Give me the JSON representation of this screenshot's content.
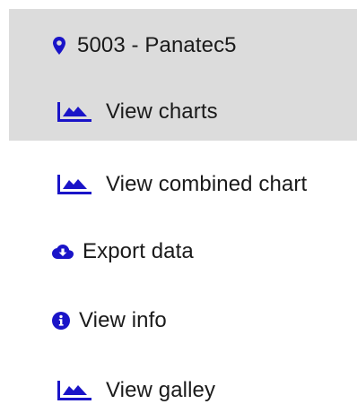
{
  "menu": {
    "items": [
      {
        "label": "5003 - Panatec5",
        "icon": "map-marker-icon"
      },
      {
        "label": "View charts",
        "icon": "area-chart-icon"
      },
      {
        "label": "View combined chart",
        "icon": "area-chart-icon"
      },
      {
        "label": "Export data",
        "icon": "cloud-download-icon"
      },
      {
        "label": "View info",
        "icon": "info-circle-icon"
      },
      {
        "label": "View galley",
        "icon": "area-chart-icon"
      }
    ]
  },
  "colors": {
    "icon": "#1a14c8",
    "text": "#1a1a1a",
    "highlight": "#dcdcdc",
    "background": "#ffffff"
  }
}
